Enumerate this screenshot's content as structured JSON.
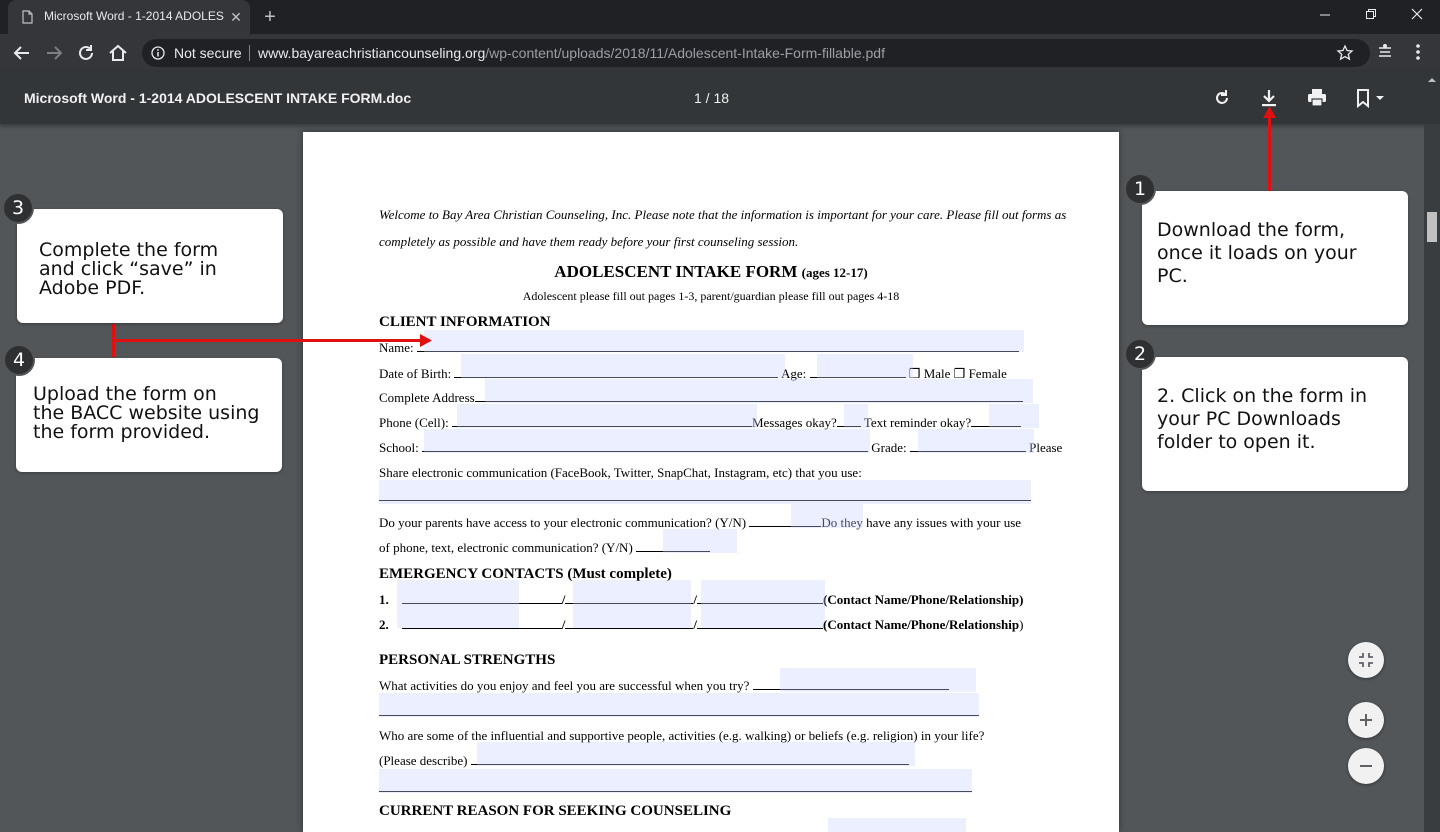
{
  "browser": {
    "tab_title": "Microsoft Word - 1-2014 ADOLESCENT INTAKE FORM.doc",
    "security_label": "Not secure",
    "url_host": "www.bayareachristiancounseling.org",
    "url_path": "/wp-content/uploads/2018/11/Adolescent-Intake-Form-fillable.pdf"
  },
  "viewer": {
    "doc_title": "Microsoft Word - 1-2014 ADOLESCENT INTAKE FORM.doc",
    "page_indicator": "1  /  18"
  },
  "pdf": {
    "welcome_1": "Welcome to Bay Area Christian Counseling, Inc. Please note that the information is important for your care. Please fill out forms as",
    "welcome_2": "completely as possible and have them ready before your first counseling session.",
    "title": "ADOLESCENT INTAKE FORM",
    "title_ages": "(ages 12-17)",
    "subtitle": "Adolescent please fill out pages 1-3, parent/guardian please fill out pages 4-18",
    "client_info_heading": "CLIENT INFORMATION",
    "name_label": "Name:",
    "dob_label": "Date of Birth:",
    "age_label": "Age:",
    "male_label": "❒ Male",
    "female_label": "❒ Female",
    "address_label": "Complete Address",
    "phone_label": "Phone (Cell):",
    "messages_label": "Messages okay?",
    "text_reminder_label": "Text reminder okay?",
    "school_label": "School:",
    "grade_label": "Grade:",
    "please_label": "Please",
    "share_label": "Share electronic communication (FaceBook, Twitter, SnapChat, Instagram, etc) that you use:",
    "parents_q1": "Do your parents have access to your electronic communication?  (Y/N)",
    "parents_q1b": "Do they have any issues with your use",
    "parents_q2": "of phone, text, electronic communication? (Y/N)",
    "emergency_heading": "EMERGENCY CONTACTS (Must complete)",
    "contact_1_num": "1.",
    "contact_2_num": "2.",
    "slash": "/",
    "contact_hint": "(Contact Name/Phone/Relationship)",
    "contact_hint_2a": "(Contact Name/Phone/Relationship",
    "contact_hint_2b": ")",
    "strengths_heading": "PERSONAL STRENGTHS",
    "activities_q": "What activities do you enjoy and feel you are successful when you try?",
    "influential_q": "Who are some of the influential and supportive people, activities (e.g. walking) or beliefs (e.g. religion) in your life?",
    "please_describe": "(Please describe)",
    "reason_heading": "CURRENT REASON FOR SEEKING COUNSELING"
  },
  "callouts": {
    "c1_num": "1",
    "c1_lines": [
      "Download the form,",
      "once it loads on your",
      "PC."
    ],
    "c2_num": "2",
    "c2_lines": [
      "2. Click on the form in",
      "your PC Downloads",
      "folder to open it."
    ],
    "c3_num": "3",
    "c3_lines": [
      "Complete the form",
      "and click “save” in",
      "Adobe PDF."
    ],
    "c4_num": "4",
    "c4_lines": [
      "Upload the form on",
      "the BACC website using",
      "the form provided."
    ]
  },
  "colors": {
    "annotation_red": "#e01010",
    "viewer_bg": "#525659",
    "toolbar_bg": "#323639"
  }
}
